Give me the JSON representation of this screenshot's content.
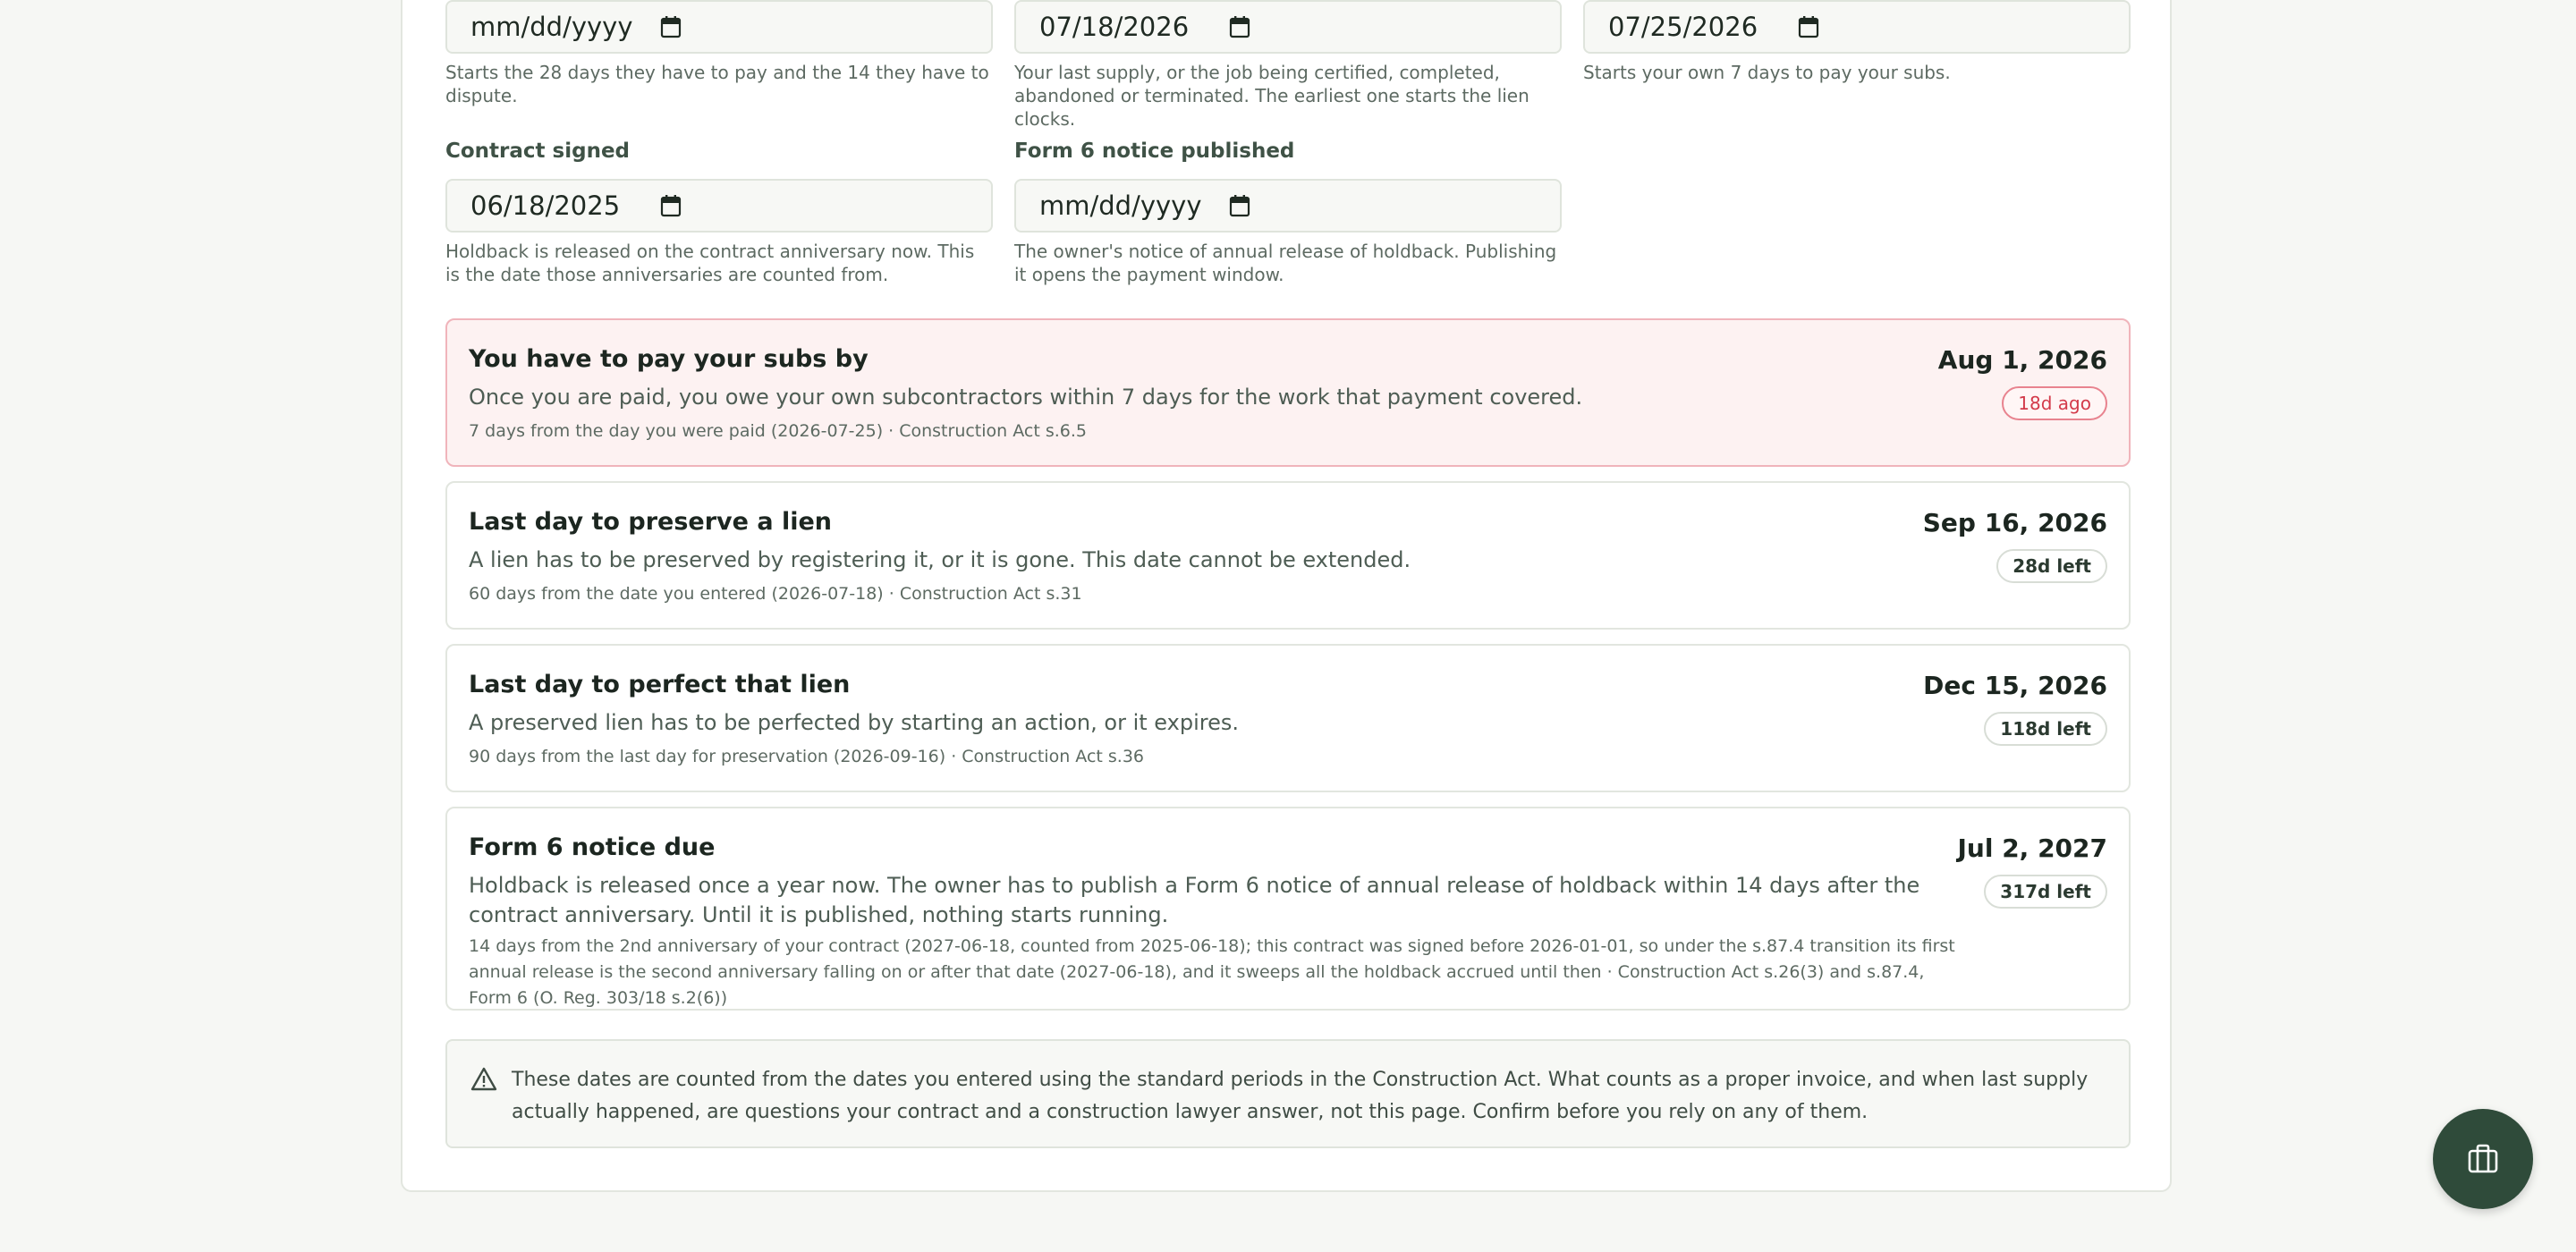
{
  "fields": [
    {
      "label": "",
      "value": "",
      "placeholder": "mm/dd/yyyy",
      "hint": "Starts the 28 days they have to pay and the 14 they have to dispute."
    },
    {
      "label": "",
      "value": "07/18/2026",
      "placeholder": "mm/dd/yyyy",
      "hint": "Your last supply, or the job being certified, completed, abandoned or terminated. The earliest one starts the lien clocks."
    },
    {
      "label": "",
      "value": "07/25/2026",
      "placeholder": "mm/dd/yyyy",
      "hint": "Starts your own 7 days to pay your subs."
    },
    {
      "label": "Contract signed",
      "value": "06/18/2025",
      "placeholder": "mm/dd/yyyy",
      "hint": "Holdback is released on the contract anniversary now. This is the date those anniversaries are counted from."
    },
    {
      "label": "Form 6 notice published",
      "value": "",
      "placeholder": "mm/dd/yyyy",
      "hint": "The owner's notice of annual release of holdback. Publishing it opens the payment window."
    }
  ],
  "deadlines": [
    {
      "title": "You have to pay your subs by",
      "date": "Aug 1, 2026",
      "badge": "18d ago",
      "status": "overdue",
      "description": "Once you are paid, you owe your own subcontractors within 7 days for the work that payment covered.",
      "source": "7 days from the day you were paid (2026-07-25) · Construction Act s.6.5"
    },
    {
      "title": "Last day to preserve a lien",
      "date": "Sep 16, 2026",
      "badge": "28d left",
      "status": "upcoming",
      "description": "A lien has to be preserved by registering it, or it is gone. This date cannot be extended.",
      "source": "60 days from the date you entered (2026-07-18) · Construction Act s.31"
    },
    {
      "title": "Last day to perfect that lien",
      "date": "Dec 15, 2026",
      "badge": "118d left",
      "status": "upcoming",
      "description": "A preserved lien has to be perfected by starting an action, or it expires.",
      "source": "90 days from the last day for preservation (2026-09-16) · Construction Act s.36"
    },
    {
      "title": "Form 6 notice due",
      "date": "Jul 2, 2027",
      "badge": "317d left",
      "status": "upcoming",
      "description": "Holdback is released once a year now. The owner has to publish a Form 6 notice of annual release of holdback within 14 days after the contract anniversary. Until it is published, nothing starts running.",
      "source": "14 days from the 2nd anniversary of your contract (2027-06-18, counted from 2025-06-18); this contract was signed before 2026-01-01, so under the s.87.4 transition its first annual release is the second anniversary falling on or after that date (2027-06-18), and it sweeps all the holdback accrued until then · Construction Act s.26(3) and s.87.4, Form 6 (O. Reg. 303/18 s.2(6))"
    }
  ],
  "disclaimer": "These dates are counted from the dates you entered using the standard periods in the Construction Act. What counts as a proper invoice, and when last supply actually happened, are questions your contract and a construction lawyer answer, not this page. Confirm before you rely on any of them.",
  "colors": {
    "accent": "#2f4b3a",
    "overdue_text": "#d33a4a",
    "overdue_bg": "#fdf2f2"
  },
  "icons": {
    "calendar": "calendar-icon",
    "warning": "warning-icon",
    "fab": "briefcase-icon"
  }
}
